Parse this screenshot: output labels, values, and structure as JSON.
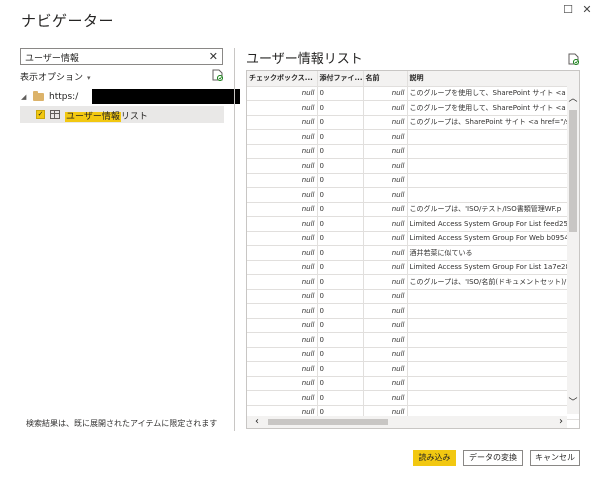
{
  "dialog": {
    "title": "ナビゲーター"
  },
  "left_pane": {
    "search": {
      "value": "ユーザー情報",
      "clear_glyph": "✕"
    },
    "display_options": "表示オプション",
    "tree": {
      "root_label": "https:/",
      "item_prefix": "ユーザー情報",
      "item_suffix": "リスト",
      "item_checked": true
    },
    "search_note": "検索結果は、既に展開されたアイテムに限定されます"
  },
  "preview": {
    "title": "ユーザー情報リスト",
    "columns": [
      "チェックボックス...",
      "添付ファイ...",
      "名前",
      "説明"
    ],
    "rows": [
      [
        "null",
        "0",
        "null",
        "このグループを使用して、SharePoint サイト <a h"
      ],
      [
        "null",
        "0",
        "null",
        "このグループを使用して、SharePoint サイト <a h"
      ],
      [
        "null",
        "0",
        "null",
        "このグループは、SharePoint サイト <a href=\"/sit"
      ],
      [
        "null",
        "0",
        "null",
        ""
      ],
      [
        "null",
        "0",
        "null",
        ""
      ],
      [
        "null",
        "0",
        "null",
        ""
      ],
      [
        "null",
        "0",
        "null",
        ""
      ],
      [
        "null",
        "0",
        "null",
        ""
      ],
      [
        "null",
        "0",
        "null",
        "このグループは、'ISO/テスト/ISO書類管理WF.p"
      ],
      [
        "null",
        "0",
        "null",
        "Limited Access System Group For List feed252d-"
      ],
      [
        "null",
        "0",
        "null",
        "Limited Access System Group For Web b0954e7c"
      ],
      [
        "null",
        "0",
        "null",
        "酒井若菜に似ている"
      ],
      [
        "null",
        "0",
        "null",
        "Limited Access System Group For List 1a7e280d-"
      ],
      [
        "null",
        "0",
        "null",
        "このグループは、'ISO/名前(ドキュメントセット)/"
      ],
      [
        "null",
        "0",
        "null",
        ""
      ],
      [
        "null",
        "0",
        "null",
        ""
      ],
      [
        "null",
        "0",
        "null",
        ""
      ],
      [
        "null",
        "0",
        "null",
        ""
      ],
      [
        "null",
        "0",
        "null",
        ""
      ],
      [
        "null",
        "0",
        "null",
        ""
      ],
      [
        "null",
        "0",
        "null",
        ""
      ],
      [
        "null",
        "0",
        "null",
        ""
      ],
      [
        "null",
        "0",
        "null",
        ""
      ]
    ]
  },
  "buttons": {
    "load": "読み込み",
    "transform": "データの変換",
    "cancel": "キャンセル"
  },
  "icons": {
    "window_restore": "restore-icon",
    "window_close": "close-icon",
    "new_table": "new-table-icon",
    "expand": "expand-triangle-icon",
    "folder": "folder-icon",
    "table": "table-icon"
  },
  "colors": {
    "accent": "#f2c811"
  }
}
